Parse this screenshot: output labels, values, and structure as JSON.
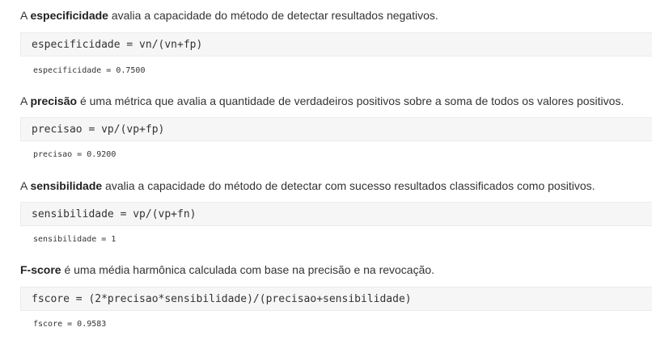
{
  "sections": [
    {
      "intro_prefix": "A ",
      "term": "especificidade",
      "intro_rest": " avalia a capacidade do método de detectar resultados negativos.",
      "code": "especificidade = vn/(vn+fp)",
      "output": "especificidade = 0.7500"
    },
    {
      "intro_prefix": "A ",
      "term": "precisão",
      "intro_rest": " é uma métrica que avalia a quantidade de verdadeiros positivos sobre a soma de todos os valores positivos.",
      "code": "precisao = vp/(vp+fp)",
      "output": "precisao = 0.9200"
    },
    {
      "intro_prefix": "A ",
      "term": "sensibilidade",
      "intro_rest": " avalia a capacidade do método de detectar com sucesso resultados classificados como positivos.",
      "code": "sensibilidade = vp/(vp+fn)",
      "output": "sensibilidade = 1"
    },
    {
      "intro_prefix": "",
      "term": "F-score",
      "intro_rest": " é uma média harmônica calculada com base na precisão e na revocação.",
      "code": "fscore = (2*precisao*sensibilidade)/(precisao+sensibilidade)",
      "output": "fscore = 0.9583"
    }
  ]
}
